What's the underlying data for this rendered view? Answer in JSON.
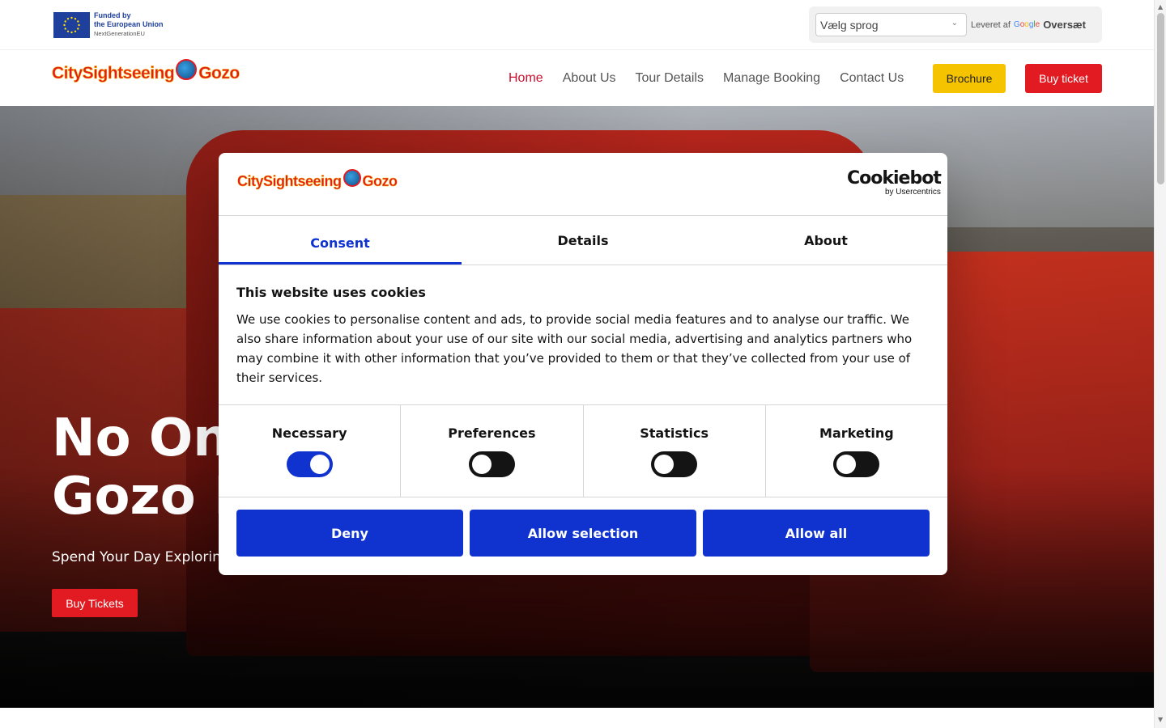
{
  "eu": {
    "line1": "Funded by",
    "line2": "the European Union",
    "line3": "NextGenerationEU"
  },
  "translate": {
    "select_label": "Vælg sprog",
    "powered_by": "Leveret af",
    "google": "Google",
    "translate_link": "Oversæt"
  },
  "brand": {
    "part1": "CitySightseeing",
    "part2": "Gozo"
  },
  "nav": {
    "items": [
      "Home",
      "About Us",
      "Tour Details",
      "Manage Booking",
      "Contact Us"
    ],
    "active": "Home",
    "brochure": "Brochure",
    "buy": "Buy ticket"
  },
  "hero": {
    "title_line1": "No On",
    "title_line2": "Gozo I",
    "subtitle": "Spend Your Day Exploring",
    "cta": "Buy Tickets"
  },
  "cookie": {
    "logo_main": "Cookiebot",
    "logo_sub": "by Usercentrics",
    "tabs": [
      "Consent",
      "Details",
      "About"
    ],
    "active_tab": "Consent",
    "title": "This website uses cookies",
    "text": "We use cookies to personalise content and ads, to provide social media features and to analyse our traffic. We also share information about your use of our site with our social media, advertising and analytics partners who may combine it with other information that you’ve provided to them or that they’ve collected from your use of their services.",
    "categories": [
      {
        "label": "Necessary",
        "on": true
      },
      {
        "label": "Preferences",
        "on": false
      },
      {
        "label": "Statistics",
        "on": false
      },
      {
        "label": "Marketing",
        "on": false
      }
    ],
    "deny": "Deny",
    "allow_selection": "Allow selection",
    "allow_all": "Allow all"
  },
  "colors": {
    "brand_red": "#e21b22",
    "brochure_yellow": "#f6c300",
    "cookie_blue": "#1032cf",
    "eu_blue": "#1e3f9c"
  }
}
